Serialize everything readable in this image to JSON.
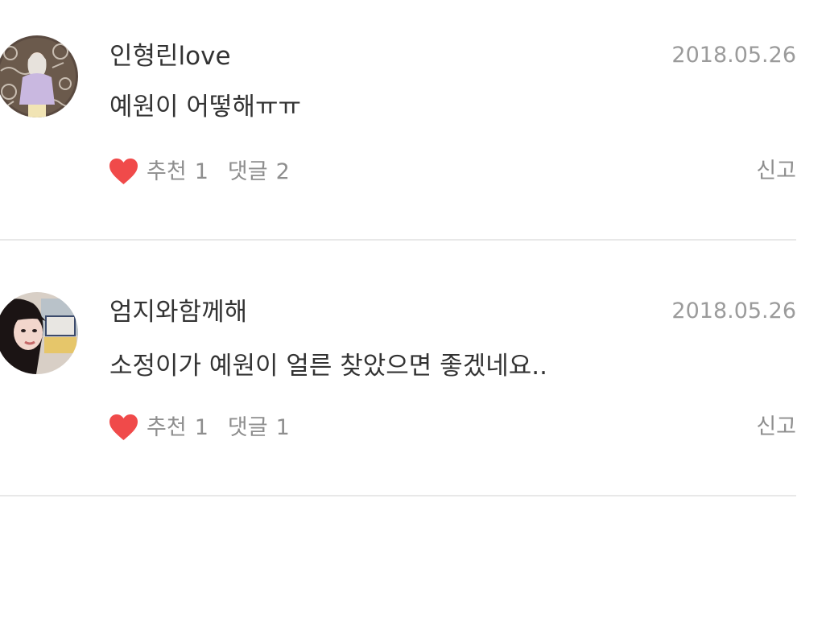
{
  "comments": [
    {
      "username": "인형린love",
      "date": "2018.05.26",
      "text": "예원이 어떻해ㅠㅠ",
      "like_label": "추천",
      "like_count": "1",
      "reply_label": "댓글",
      "reply_count": "2",
      "report_label": "신고"
    },
    {
      "username": "엄지와함께해",
      "date": "2018.05.26",
      "text": "소정이가 예원이 얼른 찾았으면 좋겠네요..",
      "like_label": "추천",
      "like_count": "1",
      "reply_label": "댓글",
      "reply_count": "1",
      "report_label": "신고"
    }
  ],
  "colors": {
    "heart": "#f04a4a",
    "meta_text": "#8e8e8e",
    "date_text": "#9b9b9b",
    "main_text": "#333333",
    "divider": "#e8e8e8"
  },
  "icons": {
    "like": "heart-icon"
  }
}
